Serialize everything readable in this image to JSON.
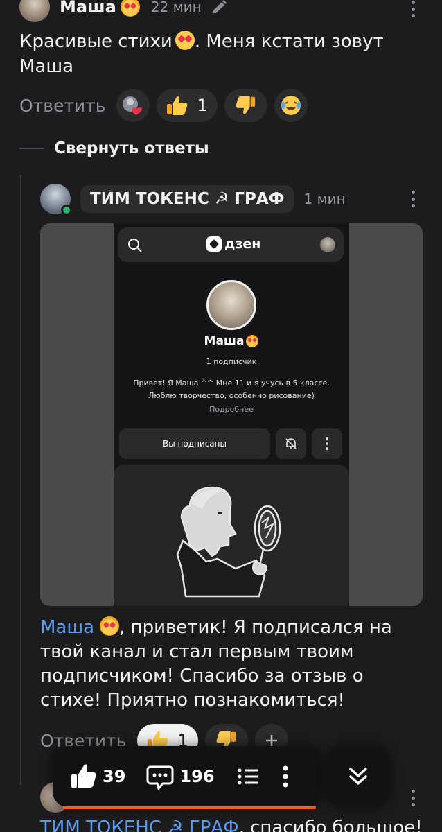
{
  "comment1": {
    "author": "Маша",
    "time": "22 мин",
    "text": "Красивые стихи",
    "text_after_emoji": ". Меня кстати зовут Маша",
    "reply_label": "Ответить",
    "like_count": "1"
  },
  "thread": {
    "collapse_label": "Свернуть ответы"
  },
  "comment2": {
    "author": "ТИМ ТОКЕНС ☭ ГРАФ",
    "time": "1 мин",
    "mention": "Маша",
    "text": ", приветик! Я подписался на твой канал и стал первым твоим подписчиком! Спасибо за отзыв о стихе! Приятно познакомиться!",
    "reply_label": "Ответить",
    "like_count": "1",
    "screenshot": {
      "logo": "дзен",
      "channel_name": "Маша",
      "subscribers": "1 подписчик",
      "bio": "Привет! Я Маша ^^ Мне 11 и я учусь в 5 классе. Люблю творчество, особенно рисование)",
      "more_link": "Подробнее",
      "subscribed_button": "Вы подписаны"
    }
  },
  "comment3": {
    "mention": "ТИМ ТОКЕНС ☭ ГРАФ",
    "text": ", спасибо большое!"
  },
  "bottom_bar": {
    "likes": "39",
    "comments": "196"
  },
  "colors": {
    "background": "#1c1c1e",
    "mention": "#5a9cf0",
    "accent_orange": "#ff5a1f",
    "online": "#2fb36a"
  }
}
